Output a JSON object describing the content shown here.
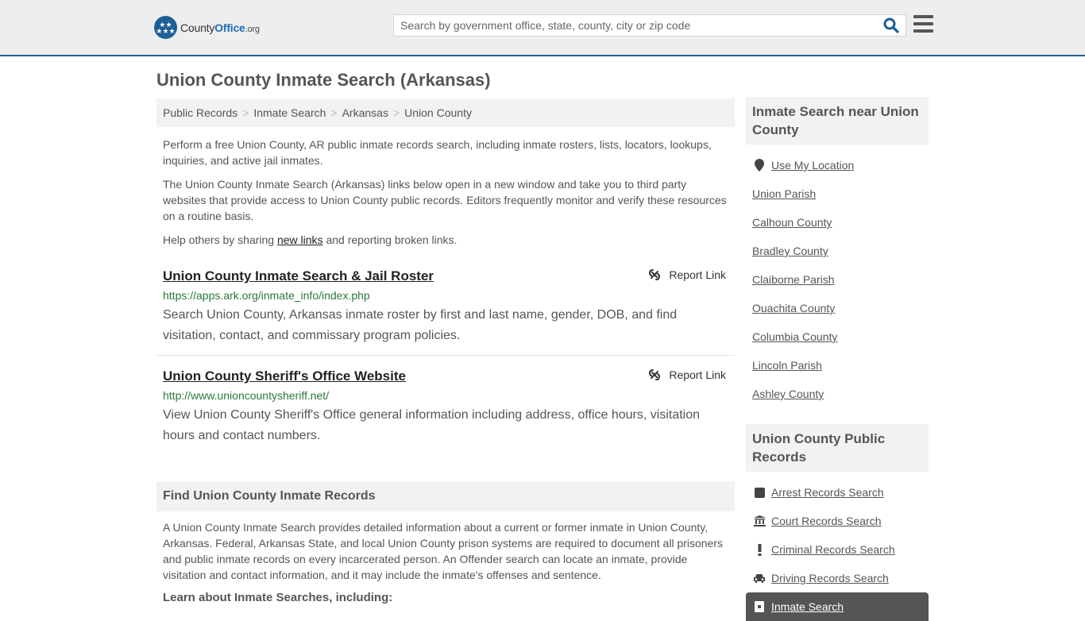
{
  "header": {
    "logo_name": "County",
    "logo_office": "Office",
    "logo_tld": ".org",
    "search_placeholder": "Search by government office, state, county, city or zip code",
    "search_value": ""
  },
  "page_title": "Union County Inmate Search (Arkansas)",
  "breadcrumb": [
    "Public Records",
    "Inmate Search",
    "Arkansas",
    "Union County"
  ],
  "intro": {
    "p1": "Perform a free Union County, AR public inmate records search, including inmate rosters, lists, locators, lookups, inquiries, and active jail inmates.",
    "p2": "The Union County Inmate Search (Arkansas) links below open in a new window and take you to third party websites that provide access to Union County public records. Editors frequently monitor and verify these resources on a routine basis.",
    "p3_before": "Help others by sharing ",
    "p3_link": "new links",
    "p3_after": " and reporting broken links."
  },
  "results": [
    {
      "title": "Union County Inmate Search & Jail Roster",
      "url": "https://apps.ark.org/inmate_info/index.php",
      "description": "Search Union County, Arkansas inmate roster by first and last name, gender, DOB, and find visitation, contact, and commissary program policies.",
      "report_label": "Report Link"
    },
    {
      "title": "Union County Sheriff's Office Website",
      "url": "http://www.unioncountysheriff.net/",
      "description": "View Union County Sheriff's Office general information including address, office hours, visitation hours and contact numbers.",
      "report_label": "Report Link"
    }
  ],
  "find_section": {
    "heading": "Find Union County Inmate Records",
    "body": "A Union County Inmate Search provides detailed information about a current or former inmate in Union County, Arkansas. Federal, Arkansas State, and local Union County prison systems are required to document all prisoners and public inmate records on every incarcerated person. An Offender search can locate an inmate, provide visitation and contact information, and it may include the inmate's offenses and sentence.",
    "learn_heading": "Learn about Inmate Searches, including:"
  },
  "sidebar": {
    "nearby_heading": "Inmate Search near Union County",
    "nearby_items": [
      {
        "label": "Use My Location",
        "icon": "map-marker-icon"
      },
      {
        "label": "Union Parish"
      },
      {
        "label": "Calhoun County"
      },
      {
        "label": "Bradley County"
      },
      {
        "label": "Claiborne Parish"
      },
      {
        "label": "Ouachita County"
      },
      {
        "label": "Columbia County"
      },
      {
        "label": "Lincoln Parish"
      },
      {
        "label": "Ashley County"
      }
    ],
    "records_heading": "Union County Public Records",
    "records_items": [
      {
        "label": "Arrest Records Search",
        "icon": "square-icon"
      },
      {
        "label": "Court Records Search",
        "icon": "courthouse-icon"
      },
      {
        "label": "Criminal Records Search",
        "icon": "exclamation-icon"
      },
      {
        "label": "Driving Records Search",
        "icon": "car-icon"
      },
      {
        "label": "Inmate Search",
        "icon": "jail-door-icon",
        "active": true
      }
    ]
  }
}
